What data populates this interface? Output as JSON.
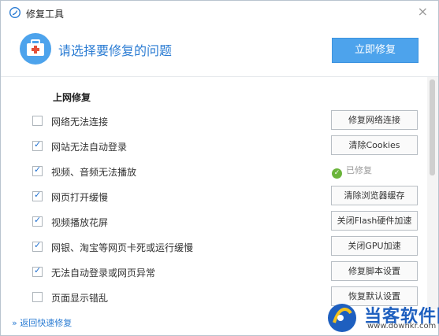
{
  "titlebar": {
    "title": "修复工具",
    "close_label": "×"
  },
  "header": {
    "prompt": "请选择要修复的问题",
    "repair_now_label": "立即修复"
  },
  "section": {
    "title": "上网修复"
  },
  "items": [
    {
      "label": "网络无法连接",
      "checked": false,
      "action": "修复网络连接",
      "status": ""
    },
    {
      "label": "网站无法自动登录",
      "checked": true,
      "action": "清除Cookies",
      "status": ""
    },
    {
      "label": "视频、音频无法播放",
      "checked": true,
      "action": "",
      "status": "已修复"
    },
    {
      "label": "网页打开缓慢",
      "checked": true,
      "action": "清除浏览器缓存",
      "status": ""
    },
    {
      "label": "视频播放花屏",
      "checked": true,
      "action": "关闭Flash硬件加速",
      "status": ""
    },
    {
      "label": "网银、淘宝等网页卡死或运行缓慢",
      "checked": true,
      "action": "关闭GPU加速",
      "status": ""
    },
    {
      "label": "无法自动登录或网页异常",
      "checked": true,
      "action": "修复脚本设置",
      "status": ""
    },
    {
      "label": "页面显示错乱",
      "checked": false,
      "action": "恢复默认设置",
      "status": ""
    }
  ],
  "footer": {
    "back_label": "返回快速修复",
    "back_prefix": "»"
  },
  "watermark": {
    "brand": "当客软件园",
    "url": "www.downkr.com"
  },
  "colors": {
    "accent": "#2b7cd3",
    "primary_button": "#4da3ec",
    "fixed_green": "#6ab43a"
  },
  "icons": {
    "app": "browser-logo-icon",
    "header": "medical-kit-icon",
    "check": "checkmark-icon"
  }
}
